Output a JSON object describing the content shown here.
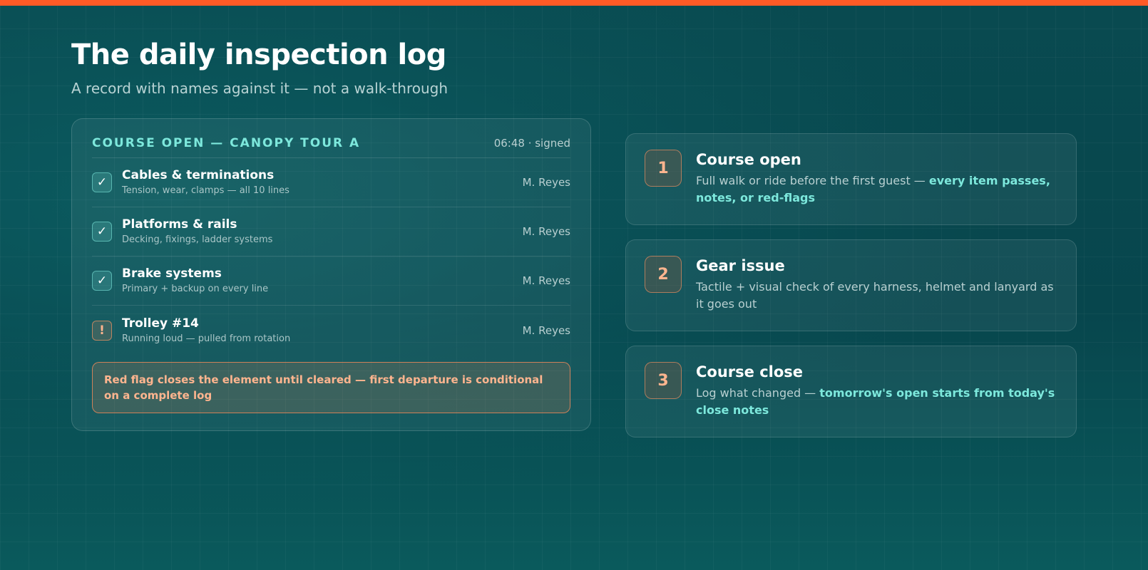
{
  "page": {
    "title": "The daily inspection log",
    "subtitle": "A record with names against it — not a walk-through"
  },
  "log": {
    "heading": "COURSE OPEN — CANOPY TOUR A",
    "stamp": "06:48 · signed",
    "rows": [
      {
        "status": "pass",
        "title": "Cables & terminations",
        "detail": "Tension, wear, clamps — all 10 lines",
        "signer": "M. Reyes"
      },
      {
        "status": "pass",
        "title": "Platforms & rails",
        "detail": "Decking, fixings, ladder systems",
        "signer": "M. Reyes"
      },
      {
        "status": "pass",
        "title": "Brake systems",
        "detail": "Primary + backup on every line",
        "signer": "M. Reyes"
      },
      {
        "status": "flag",
        "title": "Trolley #14",
        "detail": "Running loud — pulled from rotation",
        "signer": "M. Reyes"
      }
    ],
    "check_glyph": "✓",
    "flag_glyph": "!",
    "note": "Red flag closes the element until cleared — first departure is conditional on a complete log"
  },
  "steps": [
    {
      "number": "1",
      "title": "Course open",
      "text": "Full walk or ride before the first guest — ",
      "highlight": "every item passes, notes, or red-flags",
      "text_after": ""
    },
    {
      "number": "2",
      "title": "Gear issue",
      "text": "Tactile + visual check of every harness, helmet and lanyard as it goes out",
      "highlight": "",
      "text_after": ""
    },
    {
      "number": "3",
      "title": "Course close",
      "text": "Log what changed — ",
      "highlight": "tomorrow's open starts from today's close notes",
      "text_after": ""
    }
  ],
  "colors": {
    "accent_bar": "#ff5a26",
    "teal_accent": "#7de8dc",
    "flag_orange": "#ffb58f"
  }
}
